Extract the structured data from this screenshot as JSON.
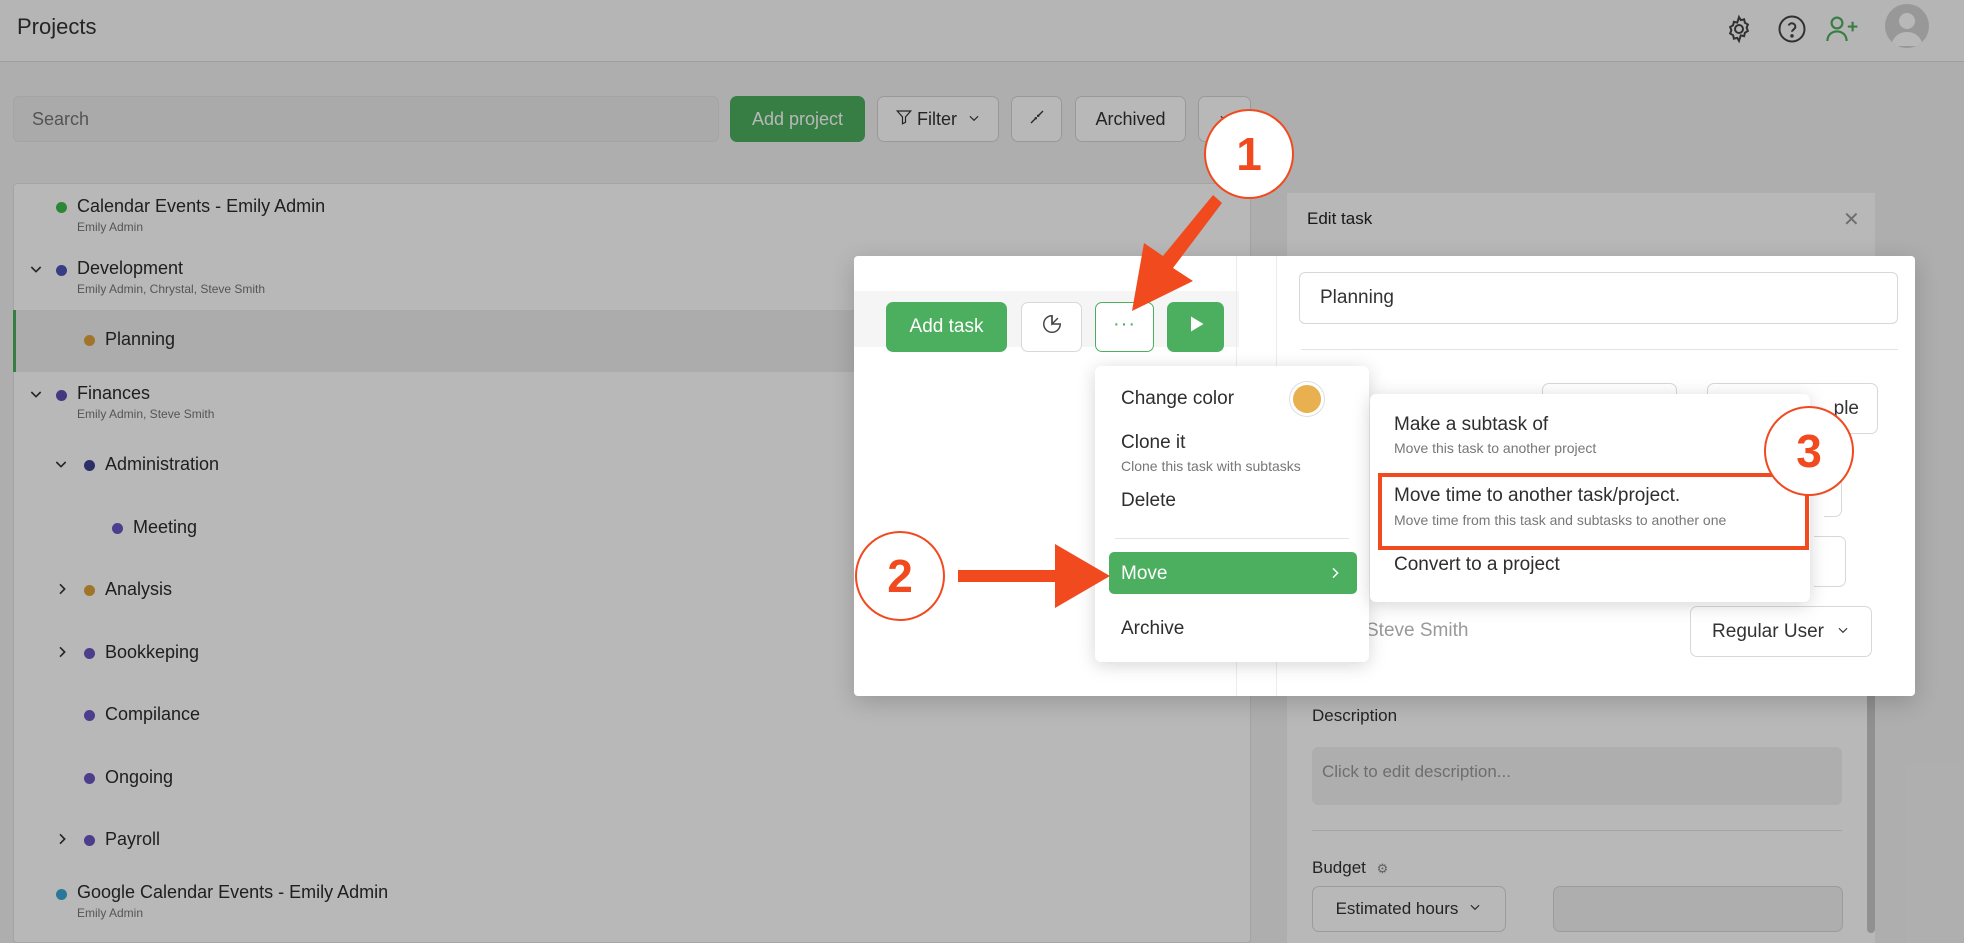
{
  "header": {
    "title": "Projects",
    "icons": [
      "gear-icon",
      "help-icon",
      "add-user-icon",
      "avatar"
    ]
  },
  "toolbar": {
    "search_placeholder": "Search",
    "add_project": "Add project",
    "filter": "Filter",
    "archived": "Archived"
  },
  "projects": [
    {
      "name": "Calendar Events - Emily Admin",
      "sub": "Emily Admin",
      "color": "#3dbb4a"
    },
    {
      "name": "Development",
      "sub": "Emily Admin, Chrystal, Steve Smith",
      "color": "#4b55b8"
    },
    {
      "name": "Planning",
      "color": "#e0a33a"
    },
    {
      "name": "Finances",
      "sub": "Emily Admin, Steve Smith",
      "color": "#5f4fb3"
    },
    {
      "name": "Administration",
      "color": "#3f3f8f"
    },
    {
      "name": "Meeting",
      "color": "#6a55c4"
    },
    {
      "name": "Analysis",
      "color": "#e0a33a"
    },
    {
      "name": "Bookkeping",
      "color": "#6a55c4"
    },
    {
      "name": "Compilance",
      "color": "#6a55c4"
    },
    {
      "name": "Ongoing",
      "color": "#6a55c4"
    },
    {
      "name": "Payroll",
      "color": "#6a55c4"
    },
    {
      "name": "Google Calendar Events - Emily Admin",
      "sub": "Emily Admin",
      "color": "#3aa7d6"
    }
  ],
  "edit_panel": {
    "title": "Edit task",
    "description_label": "Description",
    "description_placeholder": "Click to edit description...",
    "budget_label": "Budget",
    "estimated_hours": "Estimated hours"
  },
  "dialog": {
    "add_task": "Add task",
    "task_name": "Planning",
    "partial_text": "ple",
    "member_name": "Steve Smith",
    "member_role": "Regular User"
  },
  "context_menu": {
    "change_color": "Change color",
    "color_swatch": "#e9b04f",
    "clone_title": "Clone it",
    "clone_sub": "Clone this task with subtasks",
    "delete": "Delete",
    "move": "Move",
    "archive": "Archive"
  },
  "submenu": {
    "subtask_title": "Make a subtask of",
    "subtask_sub": "Move this task to another project",
    "move_time_title": "Move time to another task/project.",
    "move_time_sub": "Move time from this task and subtasks to another one",
    "convert": "Convert to a project"
  },
  "annotations": {
    "step1": "1",
    "step2": "2",
    "step3": "3",
    "accent": "#f04a1e"
  }
}
